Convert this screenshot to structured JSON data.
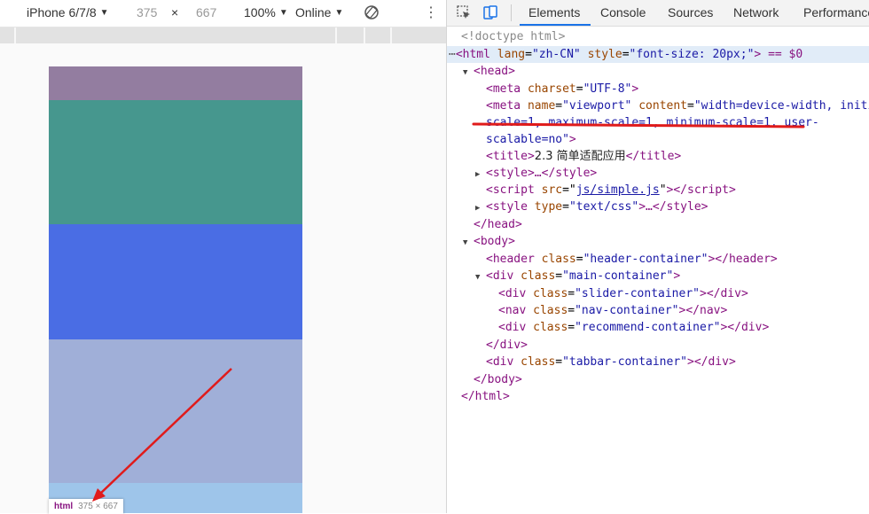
{
  "device_toolbar": {
    "device": "iPhone 6/7/8",
    "width": "375",
    "times": "×",
    "height": "667",
    "zoom": "100%",
    "network": "Online"
  },
  "devtools": {
    "tabs": [
      "Elements",
      "Console",
      "Sources",
      "Network",
      "Performance"
    ],
    "active_tab": "Elements"
  },
  "dom": {
    "doctype": "<!doctype html>",
    "html_open_prefix": "<html",
    "html_lang_attr": "lang",
    "html_lang_val": "\"zh-CN\"",
    "html_style_attr": "style",
    "html_style_val": "\"font-size: 20px;\"",
    "html_suffix": "> == $0",
    "head_open": "<head>",
    "meta_charset_attr": "charset",
    "meta_charset_val": "\"UTF-8\"",
    "meta_viewport_name_attr": "name",
    "meta_viewport_name_val": "\"viewport\"",
    "meta_viewport_content_attr": "content",
    "meta_viewport_content_val_1": "\"width=device-width, initial-",
    "meta_viewport_content_val_2": "scale=1, maximum-scale=1, minimum-scale=1, user-",
    "meta_viewport_content_val_3": "scalable=no\"",
    "title_text": "2.3 简单适配应用",
    "style_collapsed": "<style>…</style>",
    "script_src_attr": "src",
    "script_src_val": "js/simple.js",
    "style_type_attr": "type",
    "style_type_val": "\"text/css\"",
    "head_close": "</head>",
    "body_open": "<body>",
    "header_class": "\"header-container\"",
    "main_class": "\"main-container\"",
    "slider_class": "\"slider-container\"",
    "nav_class": "\"nav-container\"",
    "recommend_class": "\"recommend-container\"",
    "tabbar_class": "\"tabbar-container\"",
    "body_close": "</body>",
    "html_close": "</html>"
  },
  "hover_badge": {
    "tag": "html",
    "size": "375 × 667"
  },
  "colors": {
    "band_header": "#937DA0",
    "band_slider": "#46978E",
    "band_nav": "#4A6DE4",
    "band_recommend": "#A0AFD8",
    "band_tabbar": "#9EC5EA",
    "annotation_red": "#E01B1B"
  }
}
